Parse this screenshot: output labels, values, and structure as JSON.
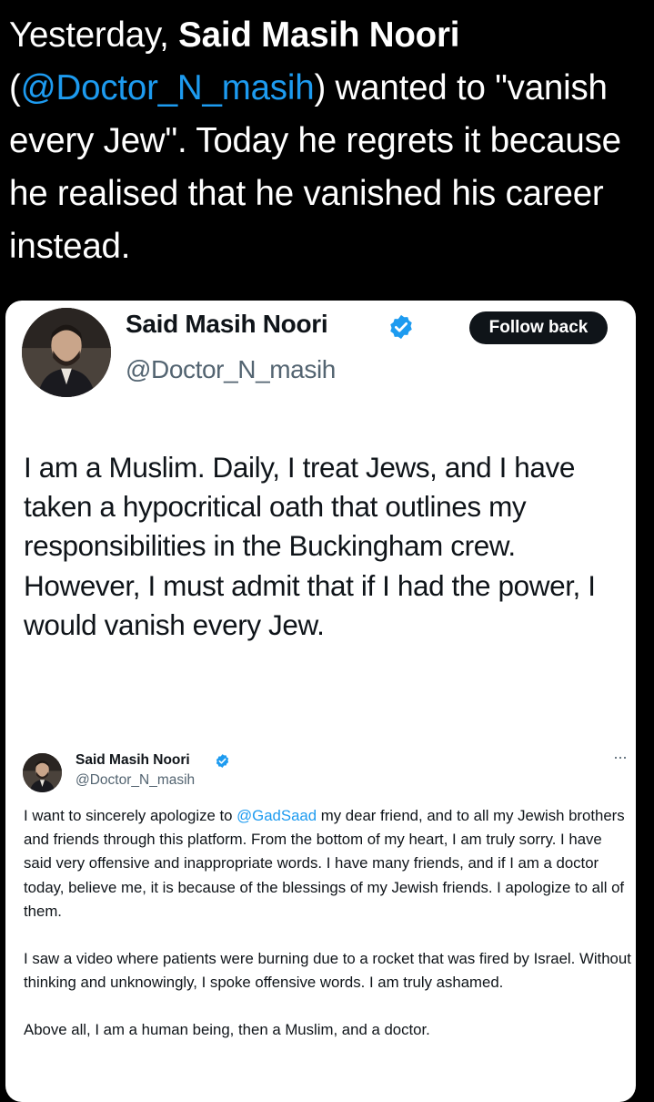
{
  "caption": {
    "part1": "Yesterday, ",
    "name": "Said Masih Noori",
    "part2": " (",
    "mention": "@Doctor_N_masih",
    "part3": ") wanted to \"vanish every Jew\". Today he regrets it because he realised that he vanished his career instead."
  },
  "tweet1": {
    "display_name": "Said Masih Noori",
    "handle": "@Doctor_N_masih",
    "follow_button": "Follow back",
    "verified_icon": "verified-badge-icon",
    "text": "I am a Muslim. Daily, I treat Jews, and I have taken a hypocritical oath that outlines my responsibilities in the Buckingham crew. However, I must admit that if I had the power, I would vanish every Jew."
  },
  "tweet2": {
    "display_name": "Said Masih Noori",
    "handle": "@Doctor_N_masih",
    "more_icon": "more-options-icon",
    "more_label": "···",
    "para1_pre": "I want to sincerely apologize to ",
    "para1_mention": "@GadSaad",
    "para1_post": " my dear friend, and to all my Jewish brothers and friends through this platform. From the bottom of my heart, I am truly sorry. I have said very offensive and inappropriate words. I have many friends, and if I am a doctor today, believe me, it is because of the blessings of my Jewish friends. I apologize to all of them.",
    "para2": "I saw a video where patients were burning due to a rocket that was fired by Israel. Without thinking and unknowingly, I spoke offensive words. I am truly ashamed.",
    "para3": "Above all, I am a human being, then a Muslim, and a doctor."
  },
  "colors": {
    "background": "#000000",
    "link": "#1d9bf0",
    "verified": "#1d9bf0",
    "follow_button": "#0f1419"
  }
}
